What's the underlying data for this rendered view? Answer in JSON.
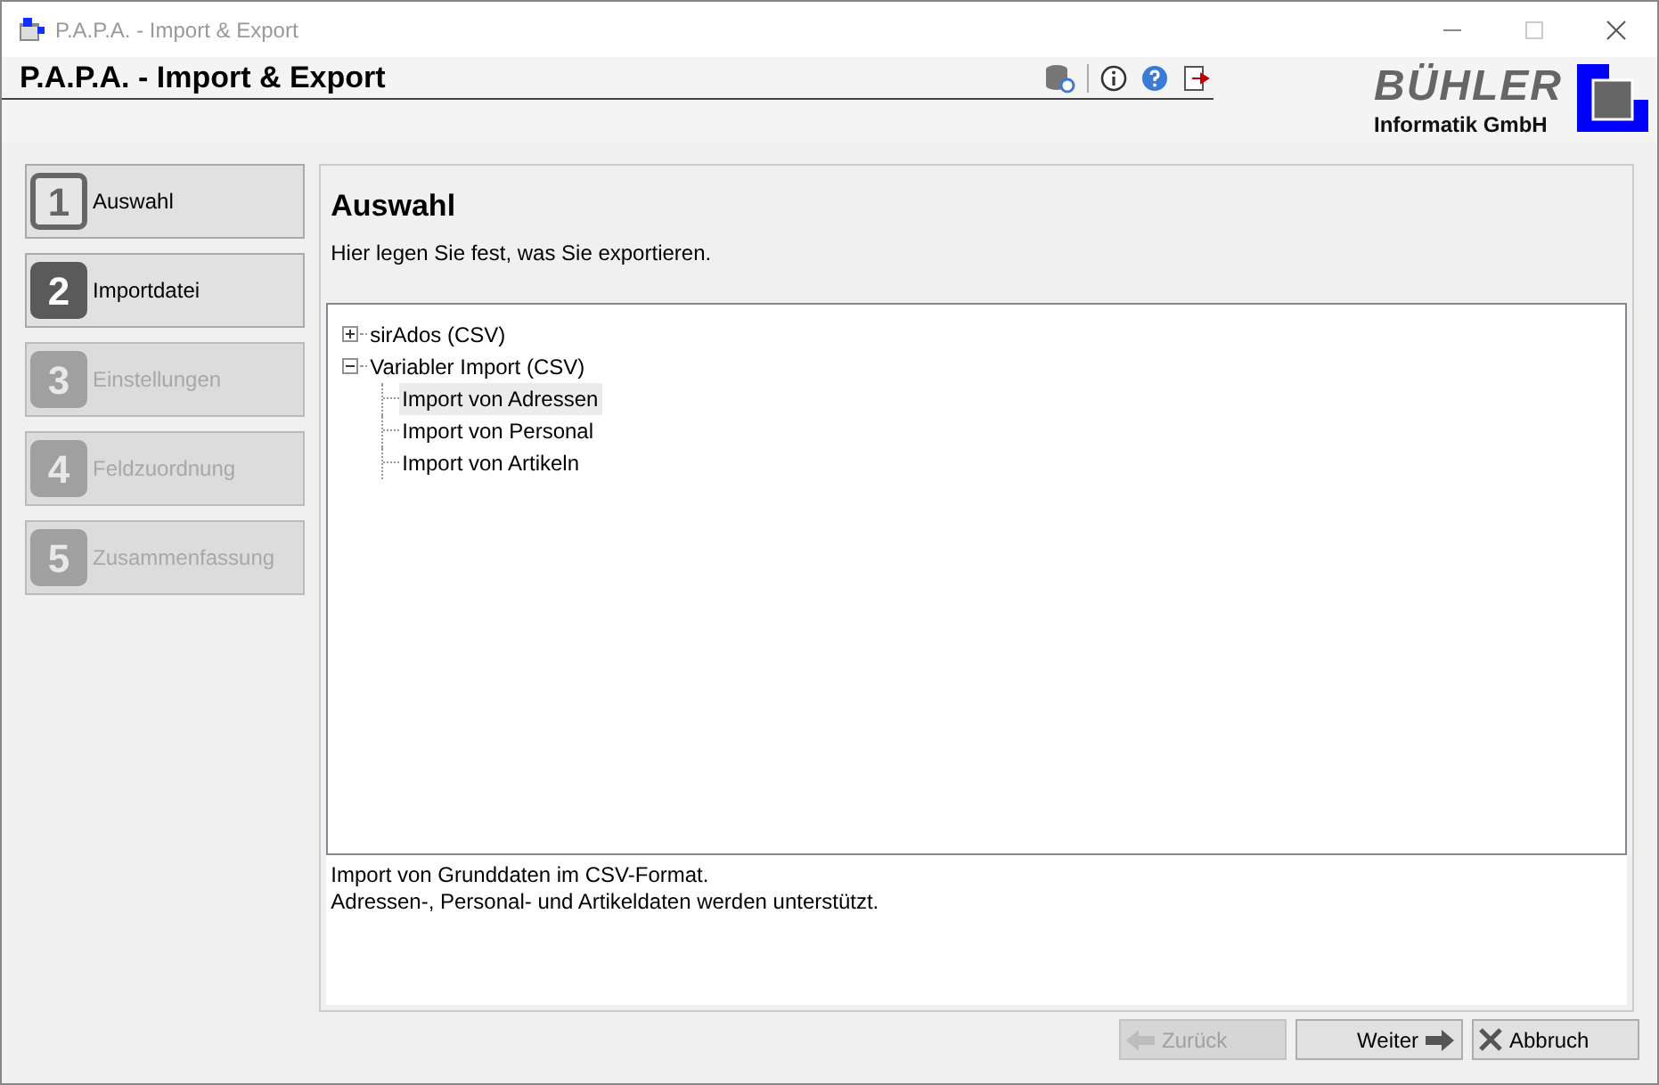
{
  "window": {
    "title": "P.A.P.A. - Import & Export"
  },
  "header": {
    "title": "P.A.P.A. - Import & Export",
    "logo_name": "BÜHLER",
    "logo_sub": "Informatik GmbH"
  },
  "steps": [
    {
      "number": "1",
      "label": "Auswahl",
      "selected": true,
      "disabled": false
    },
    {
      "number": "2",
      "label": "Importdatei",
      "selected": false,
      "disabled": false
    },
    {
      "number": "3",
      "label": "Einstellungen",
      "selected": false,
      "disabled": true
    },
    {
      "number": "4",
      "label": "Feldzuordnung",
      "selected": false,
      "disabled": true
    },
    {
      "number": "5",
      "label": "Zusammenfassung",
      "selected": false,
      "disabled": true
    }
  ],
  "page": {
    "title": "Auswahl",
    "subtitle": "Hier legen Sie fest, was Sie exportieren."
  },
  "tree": [
    {
      "label": "sirAdos (CSV)",
      "expanded": false,
      "selected": false
    },
    {
      "label": "Variabler Import (CSV)",
      "expanded": true,
      "selected": false,
      "children": [
        {
          "label": "Import von Adressen",
          "selected": true
        },
        {
          "label": "Import von Personal",
          "selected": false
        },
        {
          "label": "Import von Artikeln",
          "selected": false
        }
      ]
    }
  ],
  "description": [
    "Import von Grunddaten im CSV-Format.",
    "Adressen-, Personal- und Artikeldaten werden unterstützt."
  ],
  "buttons": [
    {
      "kind": "back",
      "label": "Zurück",
      "disabled": true
    },
    {
      "kind": "next",
      "label": "Weiter",
      "disabled": false
    },
    {
      "kind": "cancel",
      "label": "Abbruch",
      "disabled": false
    }
  ]
}
